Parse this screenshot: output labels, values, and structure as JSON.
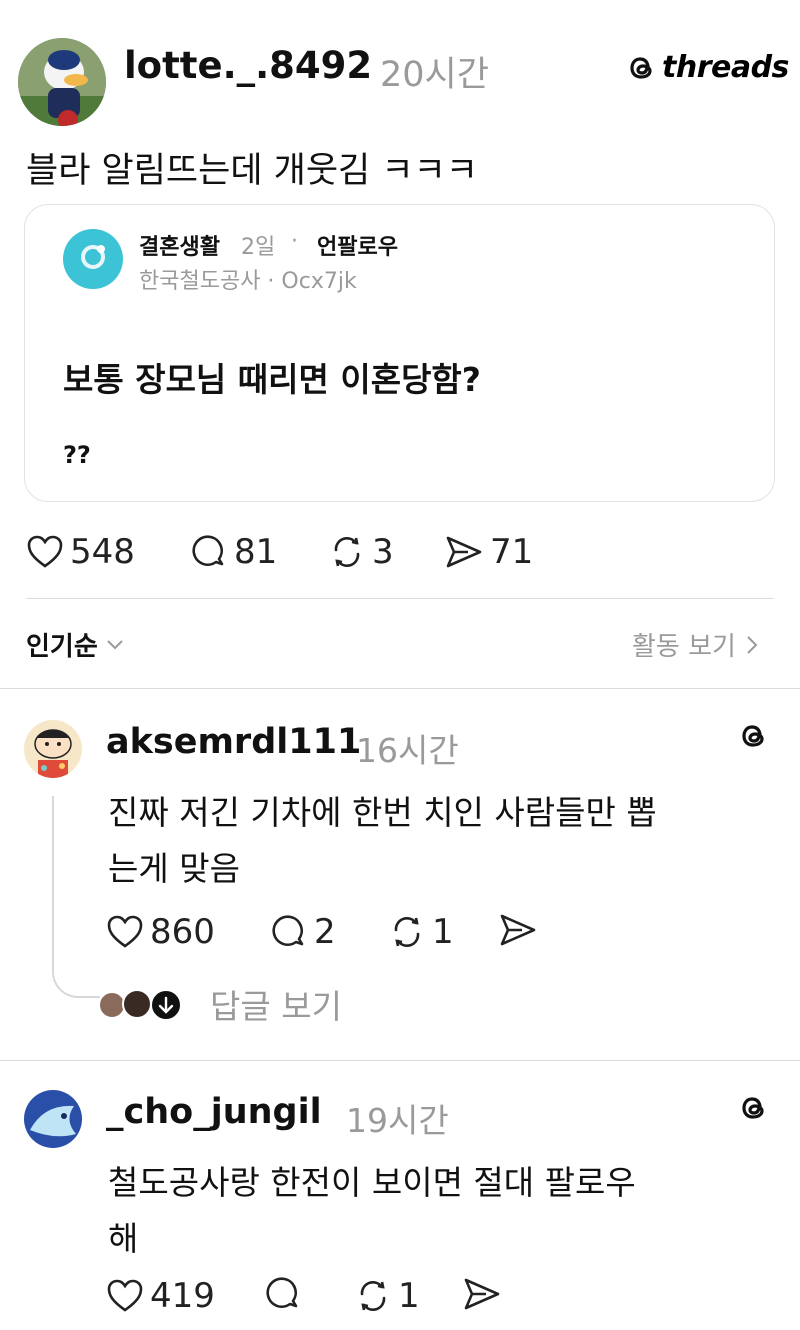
{
  "post": {
    "username": "lotte._.8492",
    "time": "20시간",
    "brand": "threads",
    "text": "블라 알림뜨는데 개웃김 ㅋㅋㅋ",
    "quote": {
      "username": "결혼생활",
      "time": "2일",
      "separator": "·",
      "unfollow": "언팔로우",
      "subtitle": "한국철도공사 · Ocx7jk",
      "title": "보통 장모님 때리면 이혼당함?",
      "body": "??"
    },
    "stats": {
      "likes": "548",
      "comments": "81",
      "reposts": "3",
      "shares": "71"
    }
  },
  "sort": {
    "label": "인기순",
    "activity": "활동 보기"
  },
  "comments": [
    {
      "username": "aksemrdl111",
      "time": "16시간",
      "line1": "진짜 저긴 기차에 한번 치인 사람들만 뽑",
      "line2": "는게 맞음",
      "likes": "860",
      "comments": "2",
      "reposts": "1",
      "view_replies": "답글 보기"
    },
    {
      "username": "_cho_jungil",
      "time": "19시간",
      "line1": "철도공사랑 한전이 보이면 절대 팔로우",
      "line2": "해",
      "likes": "419",
      "reposts": "1"
    }
  ],
  "colors": {
    "text": "#111111",
    "muted": "#9a9a9a",
    "border": "#dcdcdc"
  },
  "icons": [
    "heart-icon",
    "comment-icon",
    "repost-icon",
    "share-icon",
    "threads-logo-icon",
    "chevron-down-icon",
    "chevron-right-icon",
    "arrow-down-icon"
  ]
}
